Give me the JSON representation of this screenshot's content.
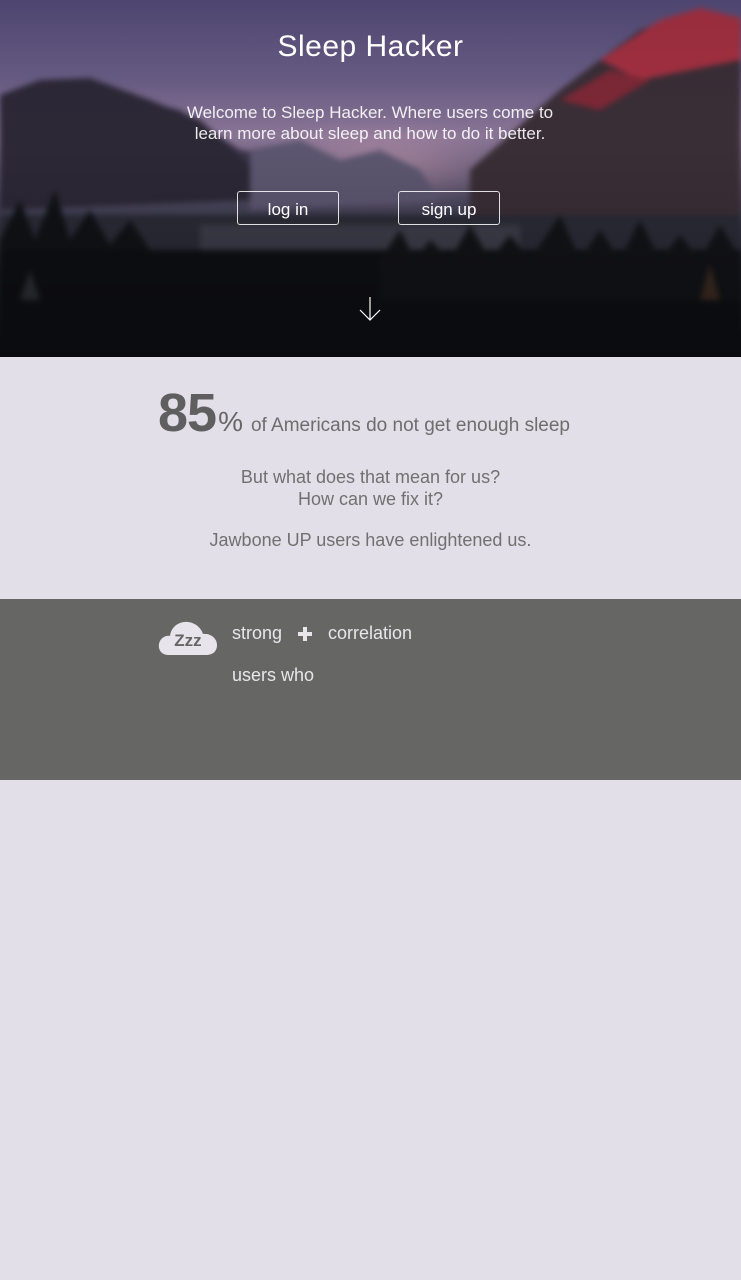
{
  "hero": {
    "title": "Sleep Hacker",
    "tagline": "Welcome to Sleep Hacker. Where users come to learn more about sleep and how to do it better.",
    "login_label": "log in",
    "signup_label": "sign up",
    "scroll_icon": "arrow-down-icon"
  },
  "stats": {
    "number": "85",
    "percent": "%",
    "text": "of Americans do not get enough sleep",
    "question_line1": "But what does that mean for us?",
    "question_line2": "How can we fix it?",
    "enlighten": "Jawbone UP users have enlightened us."
  },
  "correlation": {
    "icon": "cloud-zzz-icon",
    "icon_text": "Zzz",
    "word_strong": "strong",
    "plus_icon": "plus-icon",
    "word_correlation": "correlation",
    "word_users": "users who"
  },
  "colors": {
    "page_bg": "#e3dfe8",
    "dark_band": "#666665",
    "stat_number": "#5f5f5f",
    "text_muted": "#707070"
  }
}
